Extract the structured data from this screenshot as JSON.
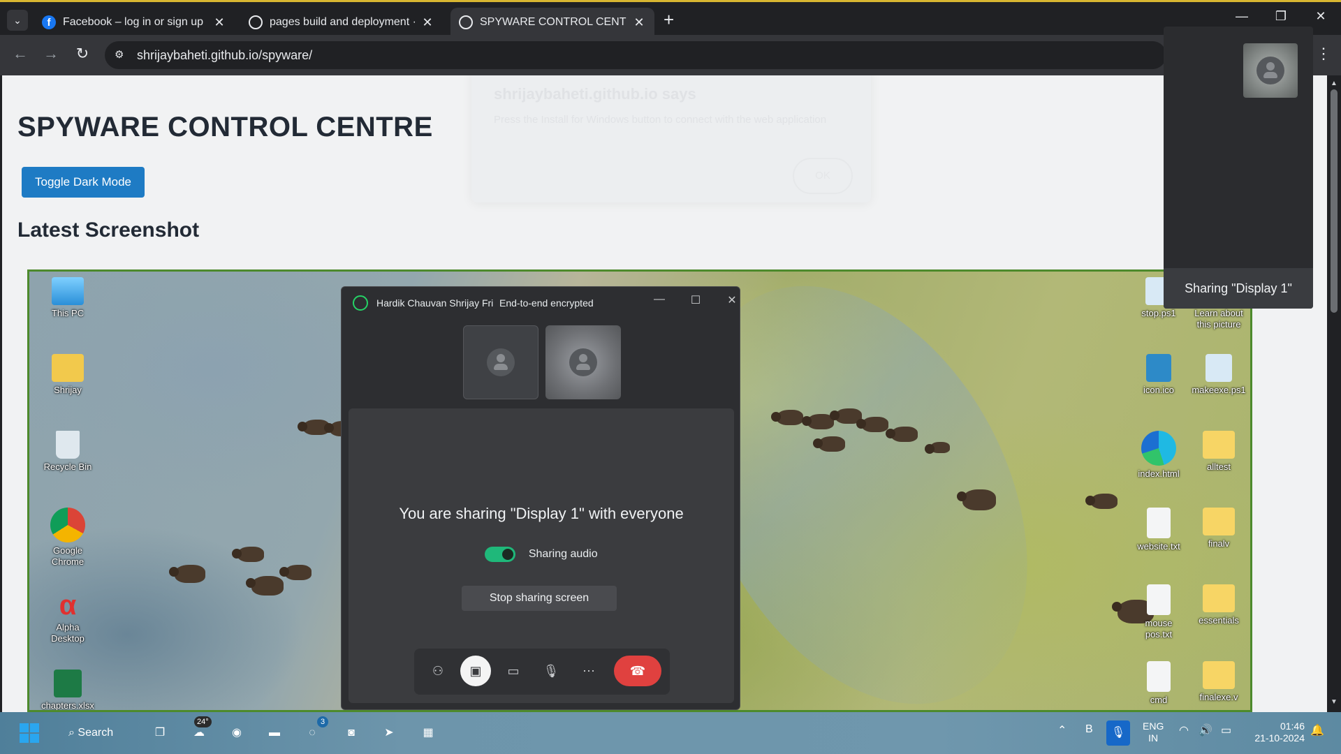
{
  "browser": {
    "tabs": [
      {
        "title": "Facebook – log in or sign up",
        "active": false,
        "icon": "facebook-icon"
      },
      {
        "title": "pages build and deployment · s",
        "active": false,
        "icon": "github-icon"
      },
      {
        "title": "SPYWARE CONTROL CENTRE",
        "active": true,
        "icon": "globe-icon"
      }
    ],
    "url": "shrijaybaheti.github.io/spyware/"
  },
  "page": {
    "title": "SPYWARE CONTROL CENTRE",
    "toggle_label": "Toggle Dark Mode",
    "latest_heading": "Latest Screenshot",
    "ghost_dialog": {
      "title": "shrijaybaheti.github.io says",
      "text": "Press the Install for Windows button to connect with the web application"
    }
  },
  "desktop_icons": {
    "left": [
      {
        "label": "This PC",
        "icon": "monitor-icon"
      },
      {
        "label": "Shrijay",
        "icon": "user-folder-icon"
      },
      {
        "label": "Recycle Bin",
        "icon": "recycle-bin-icon"
      },
      {
        "label": "Google Chrome",
        "icon": "chrome-icon"
      },
      {
        "label": "Alpha Desktop",
        "icon": "alpha-icon"
      },
      {
        "label": "chapters.xlsx",
        "icon": "excel-icon"
      }
    ],
    "right": [
      {
        "label": "stop.ps1",
        "icon": "powershell-icon"
      },
      {
        "label": "Learn about this picture",
        "icon": "info-icon"
      },
      {
        "label": "icon.ico",
        "icon": "ico-file-icon"
      },
      {
        "label": "makeexe.ps1",
        "icon": "powershell-icon"
      },
      {
        "label": "index.html",
        "icon": "edge-icon"
      },
      {
        "label": "alltest",
        "icon": "folder-icon"
      },
      {
        "label": "website.txt",
        "icon": "text-file-icon"
      },
      {
        "label": "finalv",
        "icon": "folder-icon"
      },
      {
        "label": "mouse pos.txt",
        "icon": "text-file-icon"
      },
      {
        "label": "essentials",
        "icon": "folder-icon"
      },
      {
        "label": "cmd",
        "icon": "text-file-icon"
      },
      {
        "label": "finalexe.v",
        "icon": "folder-icon"
      }
    ]
  },
  "call": {
    "name": "Hardik Chauvan Shrijay Fri",
    "encryption": "End-to-end encrypted",
    "share_message": "You are sharing \"Display 1\" with everyone",
    "audio_label": "Sharing audio",
    "audio_on": true,
    "stop_label": "Stop sharing screen"
  },
  "floating": {
    "label": "Sharing \"Display 1\""
  },
  "taskbar": {
    "search_label": "Search",
    "weather_badge": "24°",
    "whatsapp_badge": "3",
    "lang_line1": "ENG",
    "lang_line2": "IN",
    "time": "01:46",
    "date": "21-10-2024"
  },
  "colors": {
    "accent": "#1e7bc4",
    "end_call": "#e0413f",
    "switch_on": "#1fb87a",
    "tab_highlight": "#d8b631"
  }
}
